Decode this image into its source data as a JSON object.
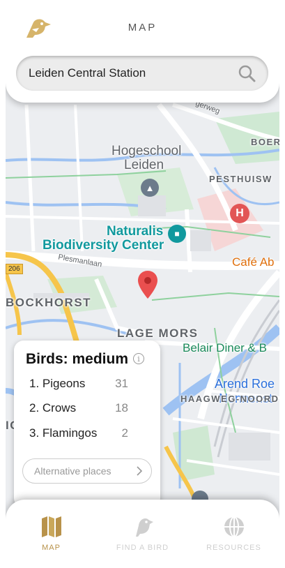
{
  "header": {
    "title": "MAP",
    "logo_icon": "bird-logo-icon",
    "accent": "#c9a75a"
  },
  "search": {
    "value": "Leiden Central Station",
    "placeholder": "",
    "icon": "search-icon"
  },
  "map": {
    "labels": {
      "area_boer": "BOER",
      "area_pesthuis": "PESTHUISW",
      "area_bockhorst": "BOCKHORST",
      "area_lage_mors": "LAGE MORS",
      "area_haagweg": "HAAGWEG-NOORD",
      "school_line1": "Hogeschool",
      "school_line2": "Leiden",
      "museum_line1": "Naturalis",
      "museum_line2": "Biodiversity Center",
      "cafe": "Café Ab",
      "diner": "Belair Diner & B",
      "arend_line1": "Arend Roe",
      "arend_line2": "Nonnenst",
      "street_plesman": "Plesmanlaan",
      "street_gerweg": "gerweg",
      "road_number": "206",
      "edge_letter": "IC"
    },
    "hospital_symbol": "H",
    "pin_icon": "location-pin-icon"
  },
  "bird_card": {
    "title": "Birds: medium",
    "info_icon": "info-icon",
    "birds": [
      {
        "name": "1. Pigeons",
        "count": "31"
      },
      {
        "name": "2. Crows",
        "count": "18"
      },
      {
        "name": "3. Flamingos",
        "count": "2"
      }
    ],
    "alternative_label": "Alternative places"
  },
  "nav": {
    "items": [
      {
        "label": "MAP",
        "icon": "map-icon",
        "active": true
      },
      {
        "label": "FIND A BIRD",
        "icon": "bird-icon",
        "active": false
      },
      {
        "label": "RESOURCES",
        "icon": "globe-icon",
        "active": false
      }
    ],
    "active_color": "#b8924a",
    "inactive_color": "#cfcfcf"
  }
}
